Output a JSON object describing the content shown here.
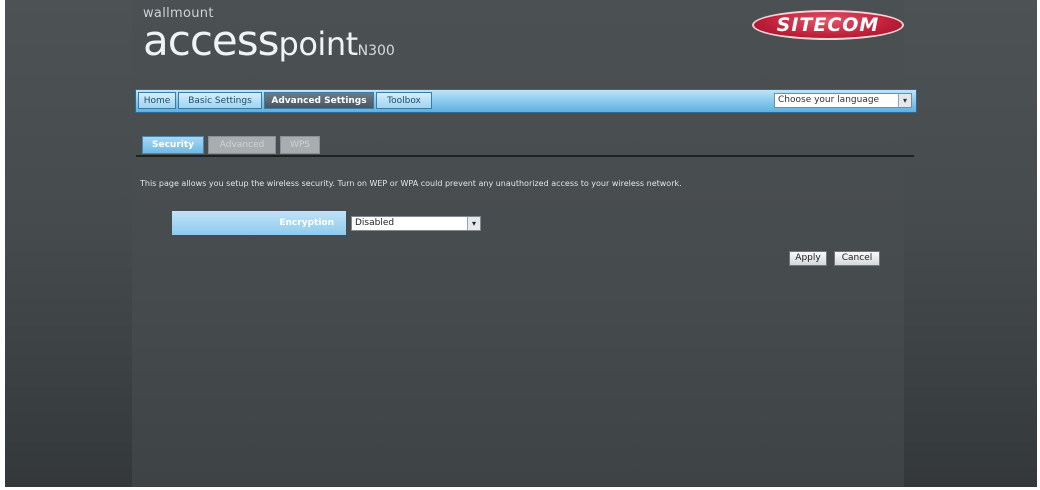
{
  "header": {
    "brand_sub": "wallmount",
    "brand_word1": "access",
    "brand_word2": "point",
    "brand_model": "N300",
    "logo_text": "SITECOM"
  },
  "nav": {
    "tabs": [
      "Home",
      "Basic Settings",
      "Advanced Settings",
      "Toolbox"
    ],
    "active_tab": "Advanced Settings",
    "language_select": "Choose your language"
  },
  "subtabs": {
    "items": [
      "Security",
      "Advanced",
      "WPS"
    ],
    "active": "Security"
  },
  "content": {
    "info_text": "This page allows you setup the wireless security. Turn on WEP or WPA could prevent any unauthorized access to your wireless network.",
    "encryption_label": "Encryption",
    "encryption_value": "Disabled"
  },
  "buttons": {
    "apply": "Apply",
    "cancel": "Cancel"
  },
  "colors": {
    "background": "#464b4d",
    "nav_blue": "#8fcdf0",
    "logo_red": "#c0203a"
  }
}
